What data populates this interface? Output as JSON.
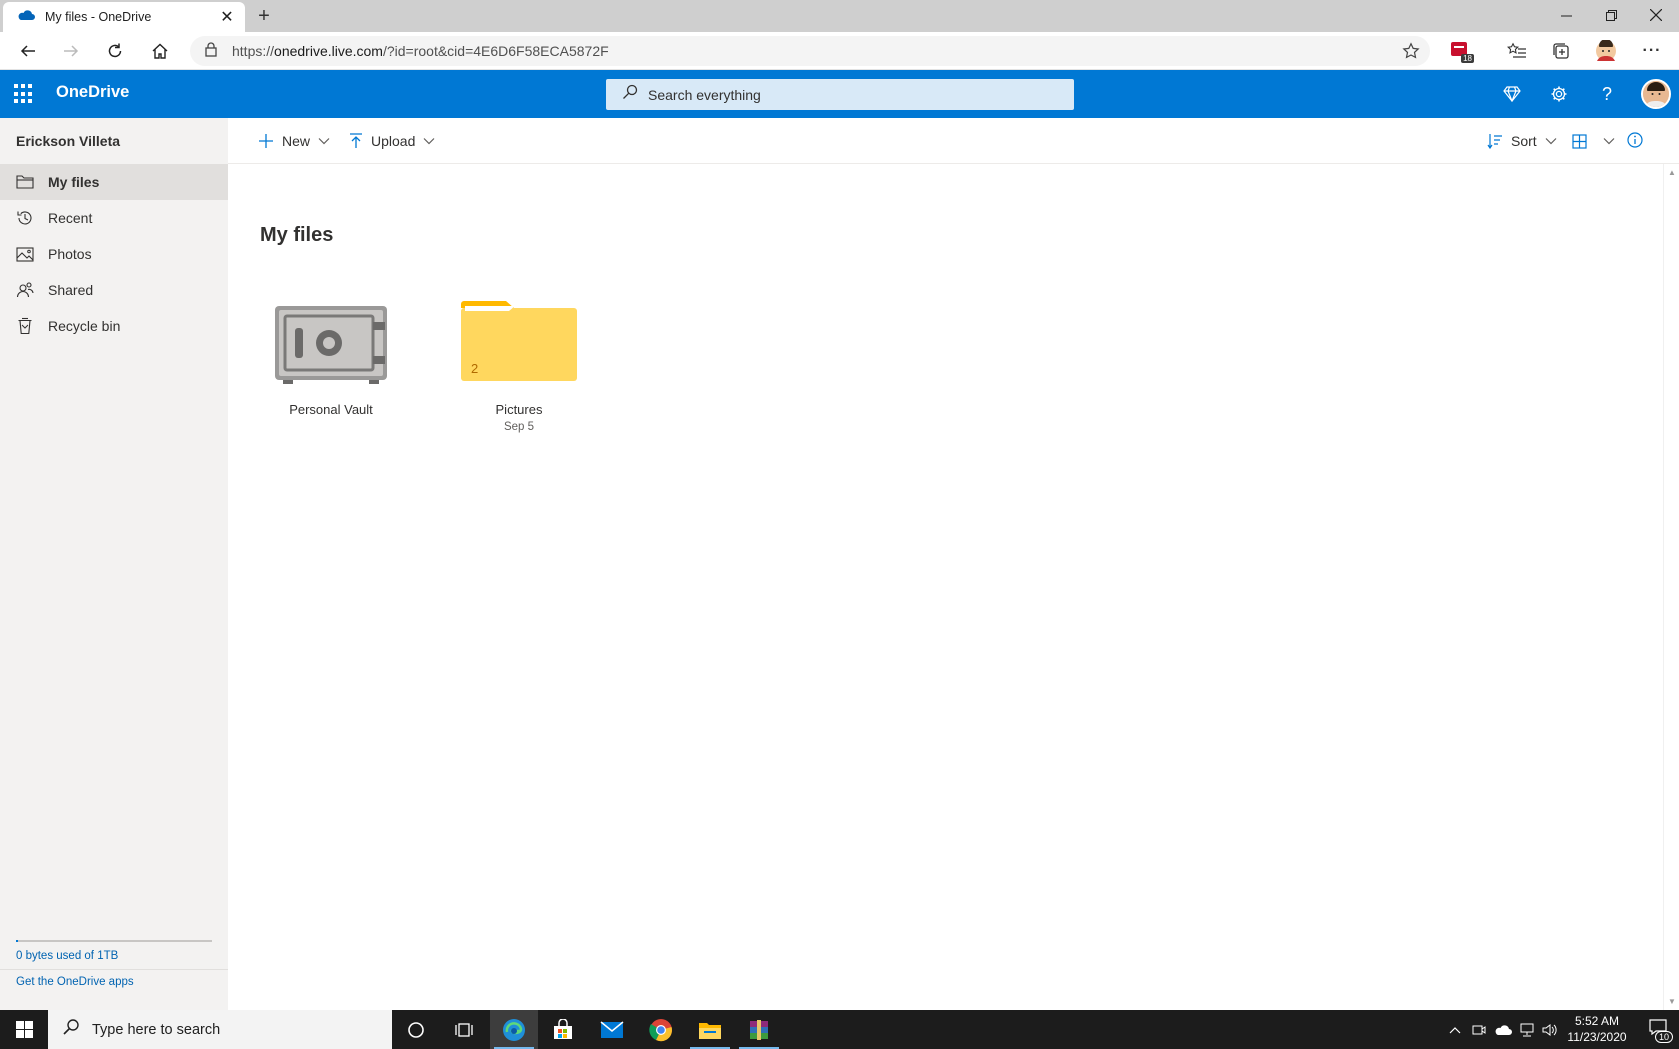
{
  "browser": {
    "tab_title": "My files - OneDrive",
    "new_tab_symbol": "+",
    "url_prefix": "https://",
    "url_host": "onedrive.live.com",
    "url_path": "/?id=root&cid=4E6D6F58ECA5872F",
    "extension_badge": "18",
    "menu_symbol": "···"
  },
  "suite": {
    "app_name": "OneDrive",
    "search_placeholder": "Search everything"
  },
  "nav": {
    "user_name": "Erickson Villeta",
    "items": [
      {
        "label": "My files",
        "icon": "folder-icon",
        "active": true
      },
      {
        "label": "Recent",
        "icon": "history-icon",
        "active": false
      },
      {
        "label": "Photos",
        "icon": "photo-icon",
        "active": false
      },
      {
        "label": "Shared",
        "icon": "people-icon",
        "active": false
      },
      {
        "label": "Recycle bin",
        "icon": "trash-icon",
        "active": false
      }
    ],
    "storage_text": "0 bytes used of 1TB",
    "storage_used_fraction": 0.01,
    "get_apps": "Get the OneDrive apps"
  },
  "commands": {
    "new_label": "New",
    "upload_label": "Upload",
    "sort_label": "Sort"
  },
  "main": {
    "title": "My files",
    "items": [
      {
        "name": "Personal Vault",
        "date": "",
        "type": "vault"
      },
      {
        "name": "Pictures",
        "date": "Sep 5",
        "type": "folder",
        "count": "2"
      }
    ]
  },
  "taskbar": {
    "search_placeholder": "Type here to search",
    "time": "5:52 AM",
    "date": "11/23/2020",
    "notification_count": "10"
  },
  "colors": {
    "accent": "#0078d4",
    "folder": "#ffd75e",
    "folder_tab": "#ffb900"
  }
}
